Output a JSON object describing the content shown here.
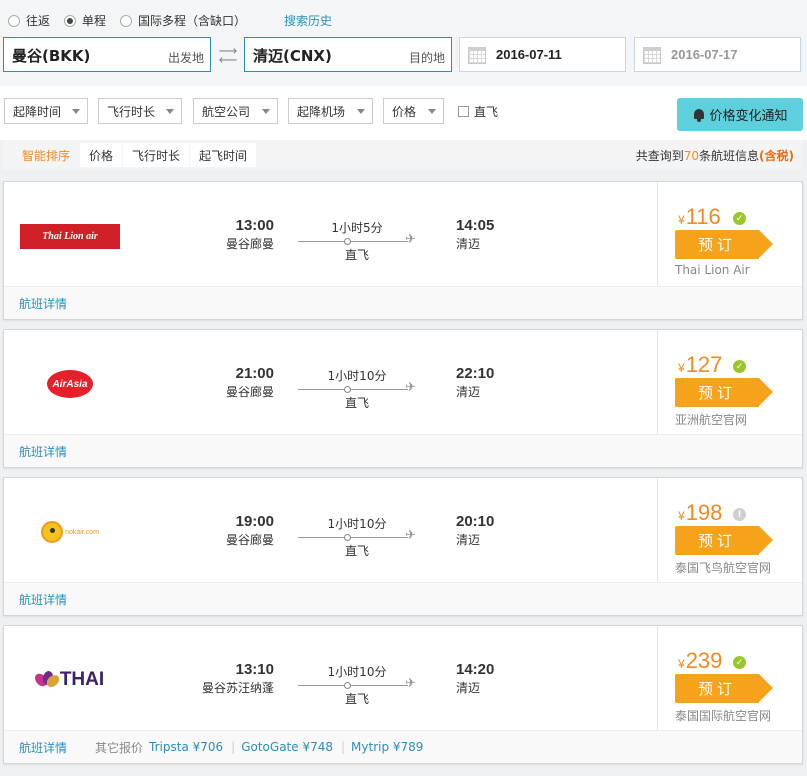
{
  "search": {
    "trip_types": [
      "往返",
      "单程",
      "国际多程（含缺口）"
    ],
    "selected_trip_type": "单程",
    "history_link": "搜索历史",
    "from_city": "曼谷(BKK)",
    "from_hint": "出发地",
    "to_city": "清迈(CNX)",
    "to_hint": "目的地",
    "depart_date": "2016-07-11",
    "return_date": "2016-07-17"
  },
  "filters": {
    "dropdowns": [
      "起降时间",
      "飞行时长",
      "航空公司",
      "起降机场",
      "价格"
    ],
    "direct_label": "直飞",
    "notify_label": "价格变化通知"
  },
  "sort": {
    "tabs": [
      "智能排序",
      "价格",
      "飞行时长",
      "起飞时间"
    ],
    "active": "智能排序",
    "count_prefix": "共查询到",
    "count": "70",
    "count_suffix": "条航班信息",
    "tax_note": "(含税)"
  },
  "flights": [
    {
      "airline_logo": "Thai Lion air",
      "dep_time": "13:00",
      "dep_airport": "曼谷廊曼",
      "duration": "1小时5分",
      "stops": "直飞",
      "arr_time": "14:05",
      "arr_airport": "清迈",
      "currency": "¥",
      "price": "116",
      "status": "ok",
      "book_label": "预订",
      "provider": "Thai Lion Air",
      "detail_label": "航班详情"
    },
    {
      "airline_logo": "AirAsia",
      "dep_time": "21:00",
      "dep_airport": "曼谷廊曼",
      "duration": "1小时10分",
      "stops": "直飞",
      "arr_time": "22:10",
      "arr_airport": "清迈",
      "currency": "¥",
      "price": "127",
      "status": "ok",
      "book_label": "预订",
      "provider": "亚洲航空官网",
      "detail_label": "航班详情"
    },
    {
      "airline_logo": "nokair.com",
      "dep_time": "19:00",
      "dep_airport": "曼谷廊曼",
      "duration": "1小时10分",
      "stops": "直飞",
      "arr_time": "20:10",
      "arr_airport": "清迈",
      "currency": "¥",
      "price": "198",
      "status": "info",
      "book_label": "预订",
      "provider": "泰国飞鸟航空官网",
      "detail_label": "航班详情"
    },
    {
      "airline_logo": "THAI",
      "dep_time": "13:10",
      "dep_airport": "曼谷苏汪纳蓬",
      "duration": "1小时10分",
      "stops": "直飞",
      "arr_time": "14:20",
      "arr_airport": "清迈",
      "currency": "¥",
      "price": "239",
      "status": "ok",
      "book_label": "预订",
      "provider": "泰国国际航空官网",
      "detail_label": "航班详情",
      "other_label": "其它报价",
      "other_quotes": [
        "Tripsta ¥706",
        "GotoGate ¥748",
        "Mytrip ¥789"
      ]
    }
  ],
  "colors": {
    "accent_orange": "#f7a21b",
    "price_orange": "#f5891f",
    "link_blue": "#2a8fbd",
    "notify_cyan": "#5ed0dc"
  }
}
